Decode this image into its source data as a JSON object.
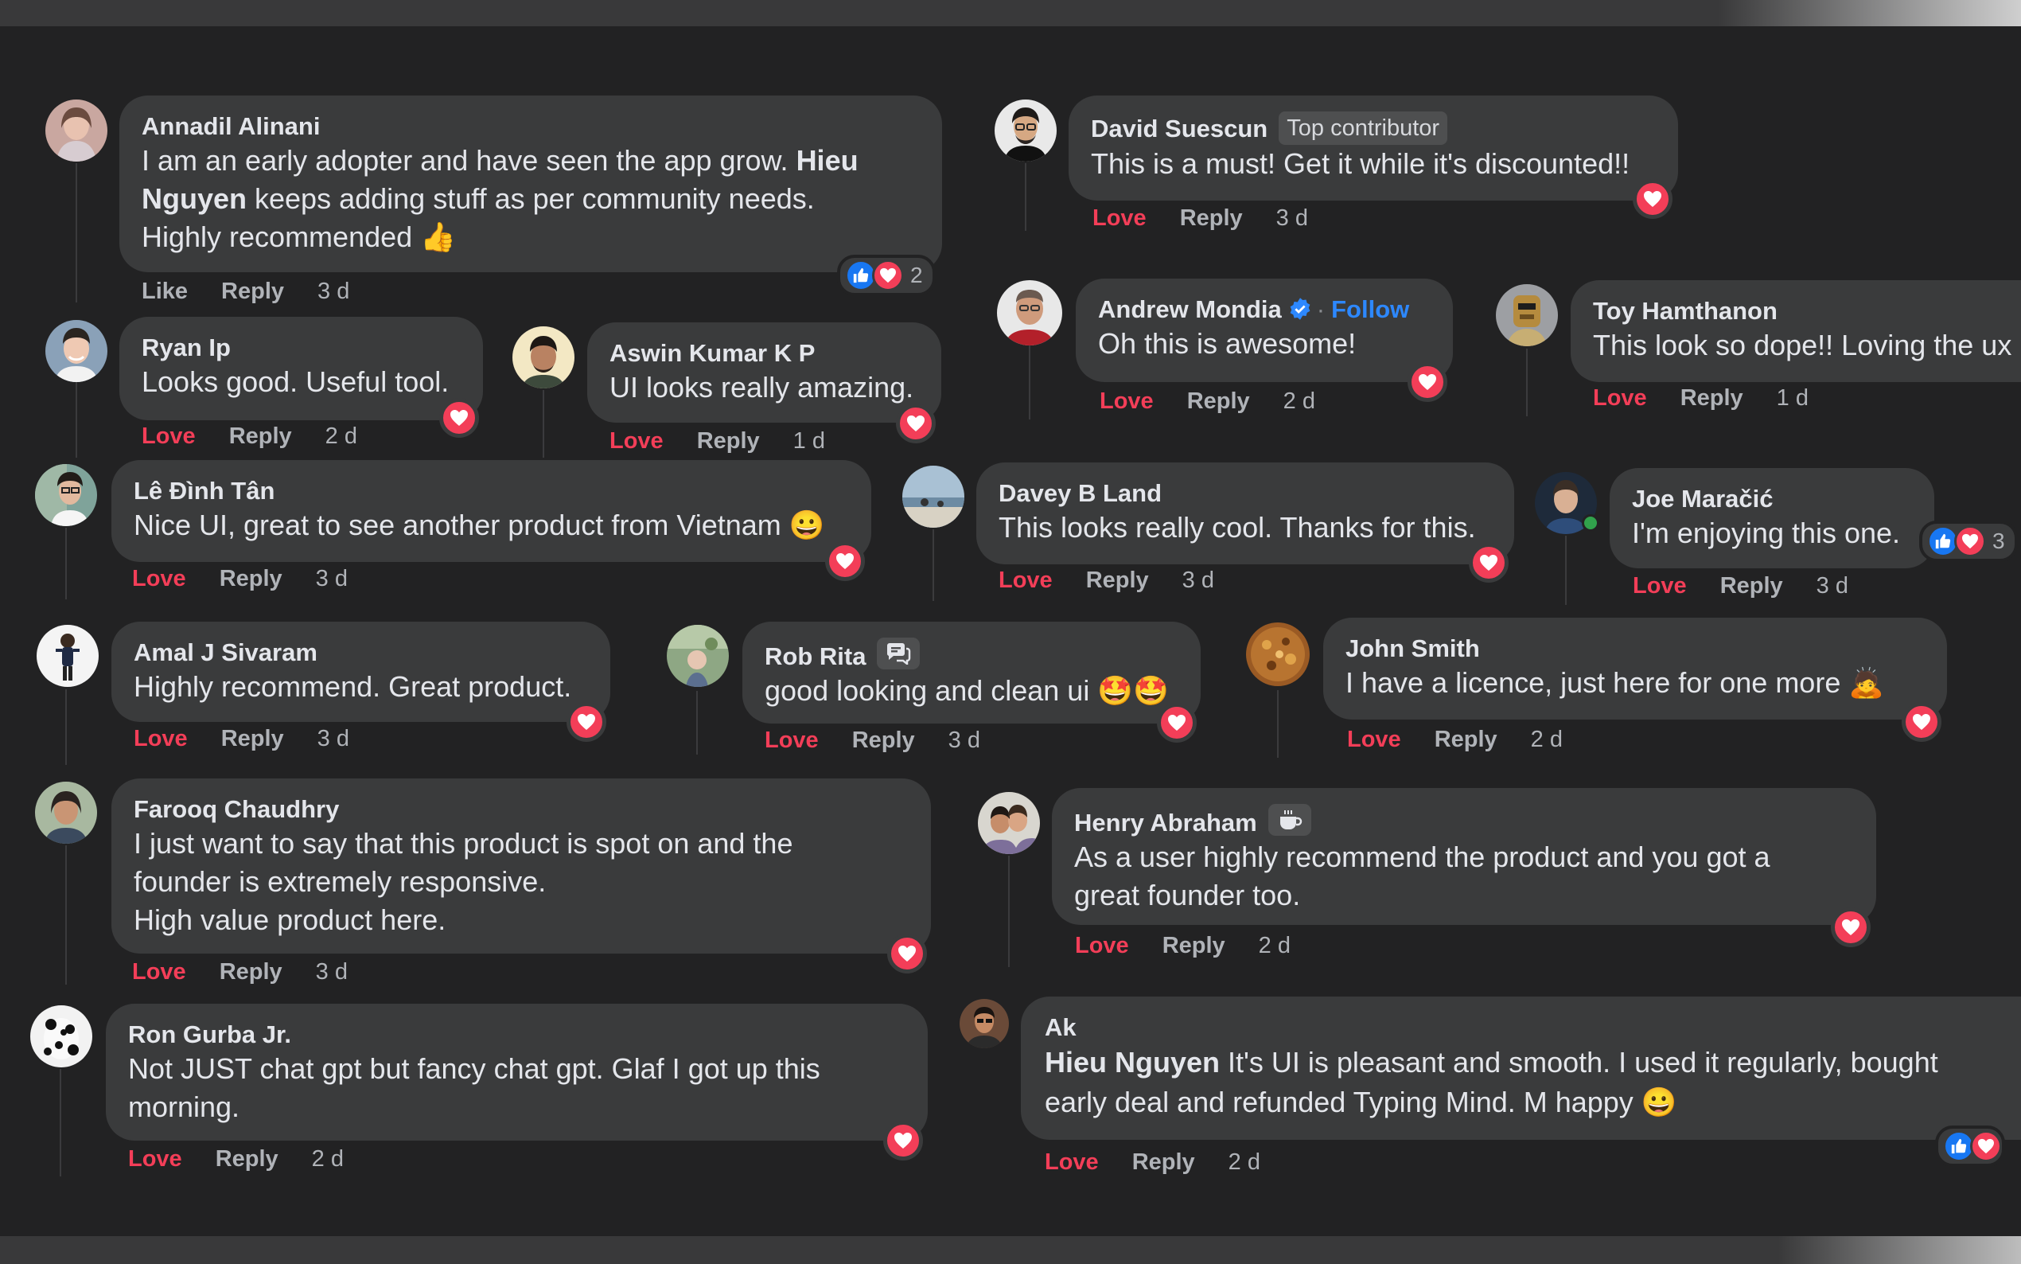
{
  "comments": [
    {
      "id": "c1",
      "author": "Annadil Alinani",
      "lines": [
        "I am an early adopter and have seen the app grow. ",
        "Hieu",
        "Nguyen",
        " keeps adding stuff as per community needs.",
        "Highly recommended"
      ],
      "emoji": "👍",
      "actions": {
        "react": "Like",
        "reply": "Reply",
        "time": "3 d"
      },
      "reactions": {
        "types": [
          "like",
          "love"
        ],
        "count": "2"
      }
    },
    {
      "id": "c2",
      "author": "David Suescun",
      "badge": "Top contributor",
      "text": "This is a must! Get it while it's discounted!!",
      "actions": {
        "react": "Love",
        "reply": "Reply",
        "time": "3 d"
      }
    },
    {
      "id": "c3",
      "author": "Ryan Ip",
      "text": "Looks good. Useful tool.",
      "actions": {
        "react": "Love",
        "reply": "Reply",
        "time": "2 d"
      }
    },
    {
      "id": "c4",
      "author": "Aswin Kumar K P",
      "text": "UI looks really amazing.",
      "actions": {
        "react": "Love",
        "reply": "Reply",
        "time": "1 d"
      }
    },
    {
      "id": "c5",
      "author": "Andrew Mondia",
      "follow": "Follow",
      "text": "Oh this is awesome!",
      "actions": {
        "react": "Love",
        "reply": "Reply",
        "time": "2 d"
      }
    },
    {
      "id": "c6",
      "author": "Toy Hamthanon",
      "text": "This look so dope!! Loving the ux",
      "actions": {
        "react": "Love",
        "reply": "Reply",
        "time": "1 d"
      }
    },
    {
      "id": "c7",
      "author": "Lê Đình Tân",
      "text": "Nice UI, great to see another product from Vietnam",
      "emoji": "😀",
      "actions": {
        "react": "Love",
        "reply": "Reply",
        "time": "3 d"
      }
    },
    {
      "id": "c8",
      "author": "Davey B Land",
      "text": "This looks really cool. Thanks for this.",
      "actions": {
        "react": "Love",
        "reply": "Reply",
        "time": "3 d"
      }
    },
    {
      "id": "c9",
      "author": "Joe Maračić",
      "text": "I'm enjoying this one.",
      "actions": {
        "react": "Love",
        "reply": "Reply",
        "time": "3 d"
      },
      "reactions": {
        "types": [
          "like",
          "love"
        ],
        "count": "3"
      }
    },
    {
      "id": "c10",
      "author": "Amal J Sivaram",
      "text": "Highly recommend. Great product.",
      "actions": {
        "react": "Love",
        "reply": "Reply",
        "time": "3 d"
      }
    },
    {
      "id": "c11",
      "author": "Rob Rita",
      "text": "good looking and clean ui",
      "emoji": "🤩🤩",
      "actions": {
        "react": "Love",
        "reply": "Reply",
        "time": "3 d"
      }
    },
    {
      "id": "c12",
      "author": "John Smith",
      "text": "I have a licence, just here for one more",
      "emoji": "🙇",
      "actions": {
        "react": "Love",
        "reply": "Reply",
        "time": "2 d"
      }
    },
    {
      "id": "c13",
      "author": "Farooq Chaudhry",
      "lines": [
        "I just want to say that this product is spot on and the",
        "founder is extremely responsive.",
        "High value product here."
      ],
      "actions": {
        "react": "Love",
        "reply": "Reply",
        "time": "3 d"
      }
    },
    {
      "id": "c14",
      "author": "Henry Abraham",
      "lines": [
        "As a user highly recommend the product and you got a",
        "great founder too."
      ],
      "actions": {
        "react": "Love",
        "reply": "Reply",
        "time": "2 d"
      }
    },
    {
      "id": "c15",
      "author": "Ron Gurba Jr.",
      "lines": [
        "Not JUST chat gpt but fancy chat gpt. Glaf I got up this",
        "morning."
      ],
      "actions": {
        "react": "Love",
        "reply": "Reply",
        "time": "2 d"
      }
    },
    {
      "id": "c16",
      "author": "Ak",
      "mention": "Hieu Nguyen",
      "lines": [
        " It's UI is pleasant and smooth. I used it regularly, bought",
        "early deal and refunded Typing Mind. M happy"
      ],
      "emoji": "😀",
      "actions": {
        "react": "Love",
        "reply": "Reply",
        "time": "2 d"
      },
      "reactions": {
        "types": [
          "like",
          "love"
        ]
      }
    }
  ],
  "colors": {
    "background": "#222223",
    "bubble": "#3a3b3c",
    "love": "#f33e58",
    "like": "#1877f2",
    "follow": "#2d88ff"
  }
}
